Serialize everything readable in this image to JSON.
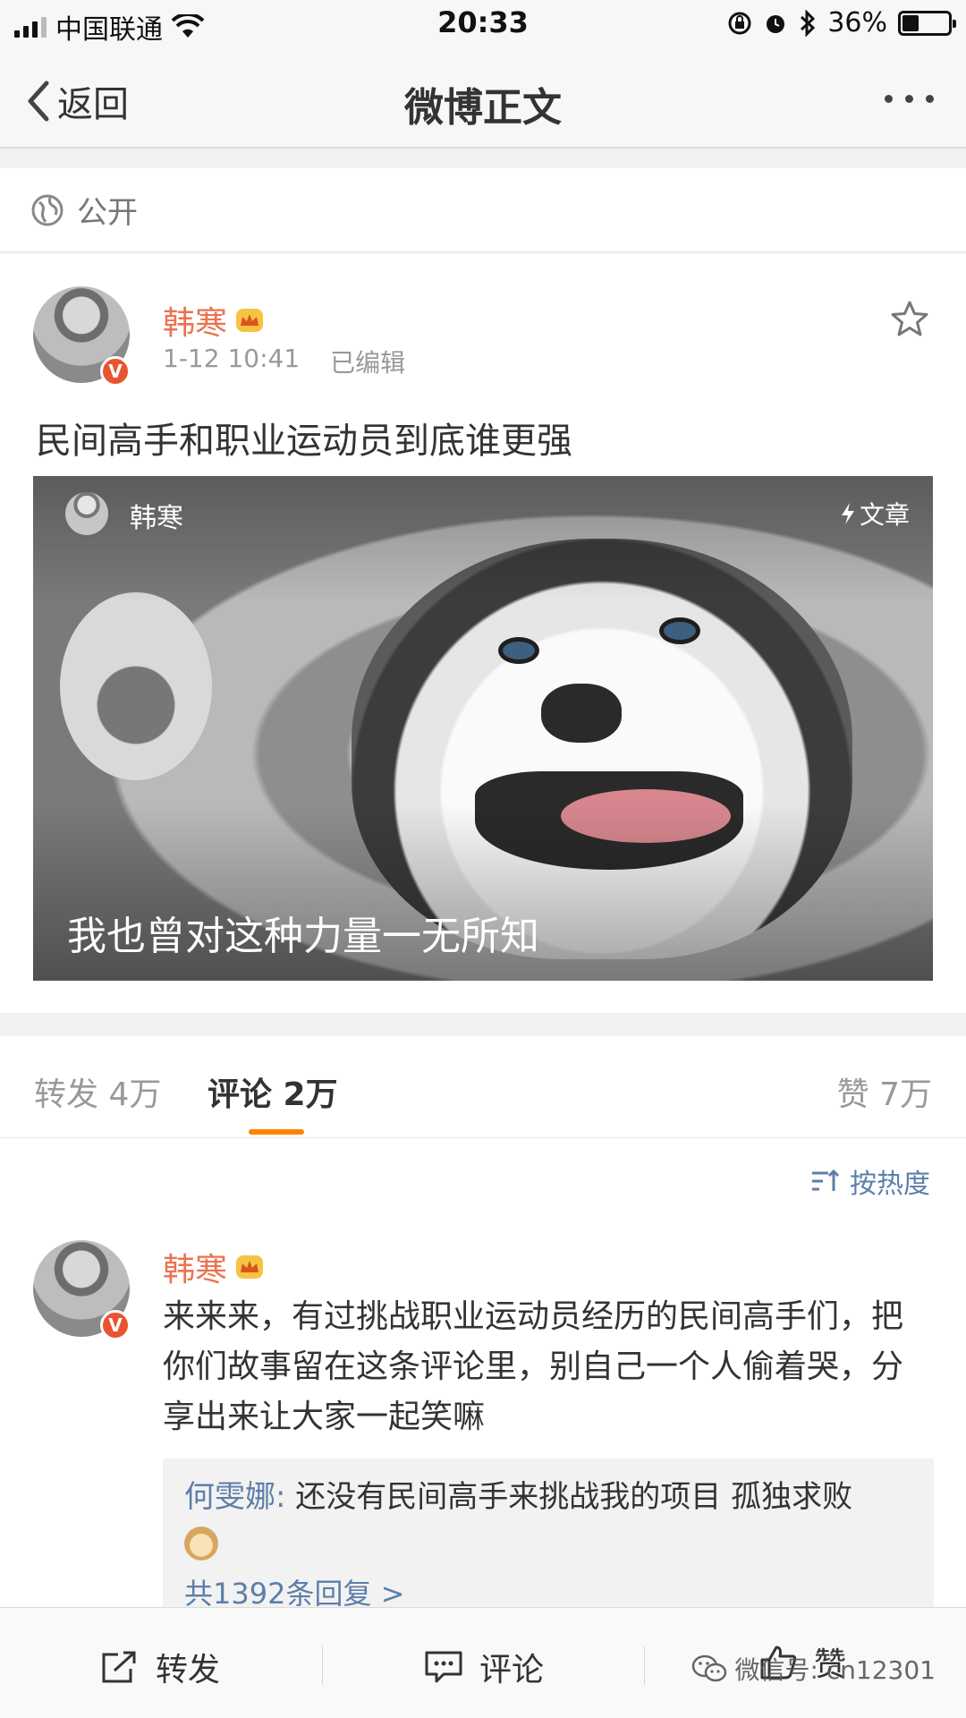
{
  "status_bar": {
    "carrier": "中国联通",
    "time": "20:33",
    "battery_pct": "36%",
    "battery_level": 0.36
  },
  "nav": {
    "back_label": "返回",
    "title": "微博正文"
  },
  "visibility": {
    "label": "公开"
  },
  "post": {
    "username": "韩寒",
    "time": "1-12 10:41",
    "edited": "已编辑",
    "text": "民间高手和职业运动员到底谁更强",
    "article": {
      "author": "韩寒",
      "tag": "文章",
      "title": "我也曾对这种力量一无所知"
    }
  },
  "tabs": {
    "repost": "转发 4万",
    "comment": "评论 2万",
    "like": "赞 7万"
  },
  "comments": {
    "sort_label": "按热度",
    "items": [
      {
        "username": "韩寒",
        "text": "来来来，有过挑战职业运动员经历的民间高手们，把你们故事留在这条评论里，别自己一个人偷着哭，分享出来让大家一起笑嘛",
        "reply": {
          "name": "何雯娜:",
          "text": " 还没有民间高手来挑战我的项目 孤独求败",
          "more": "共1392条回复 >"
        }
      }
    ]
  },
  "toolbar": {
    "repost": "转发",
    "comment": "评论",
    "like": "赞"
  },
  "watermark": "微信号: cn12301",
  "colors": {
    "accent_orange": "#ff8200",
    "username_orange": "#eb7350",
    "link_blue": "#5c7fa9",
    "verified_red": "#e8542f"
  }
}
